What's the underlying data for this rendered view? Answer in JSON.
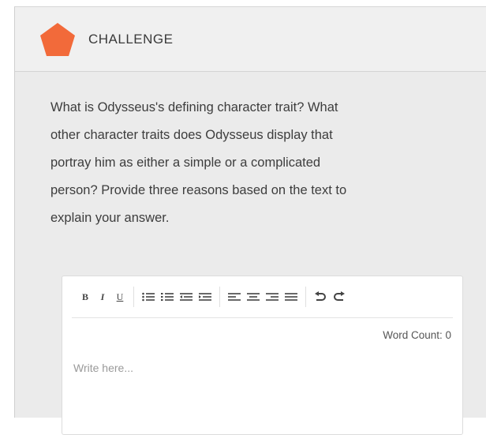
{
  "header": {
    "title": "CHALLENGE",
    "icon": "pentagon-icon",
    "icon_color": "#f26a3a"
  },
  "prompt": {
    "lines": [
      "What is Odysseus's defining character trait? What",
      "other character traits does Odysseus display that",
      "portray him as either a simple or a complicated",
      "person? Provide three reasons based on the text to",
      "explain your answer."
    ]
  },
  "editor": {
    "toolbar": {
      "bold": "B",
      "italic": "I",
      "underline": "U",
      "icons": [
        "bullet-list-icon",
        "numbered-list-icon",
        "outdent-icon",
        "indent-icon",
        "align-left-icon",
        "align-center-icon",
        "align-right-icon",
        "align-justify-icon",
        "undo-icon",
        "redo-icon"
      ]
    },
    "word_count": "Word Count: 0",
    "placeholder": "Write here..."
  }
}
